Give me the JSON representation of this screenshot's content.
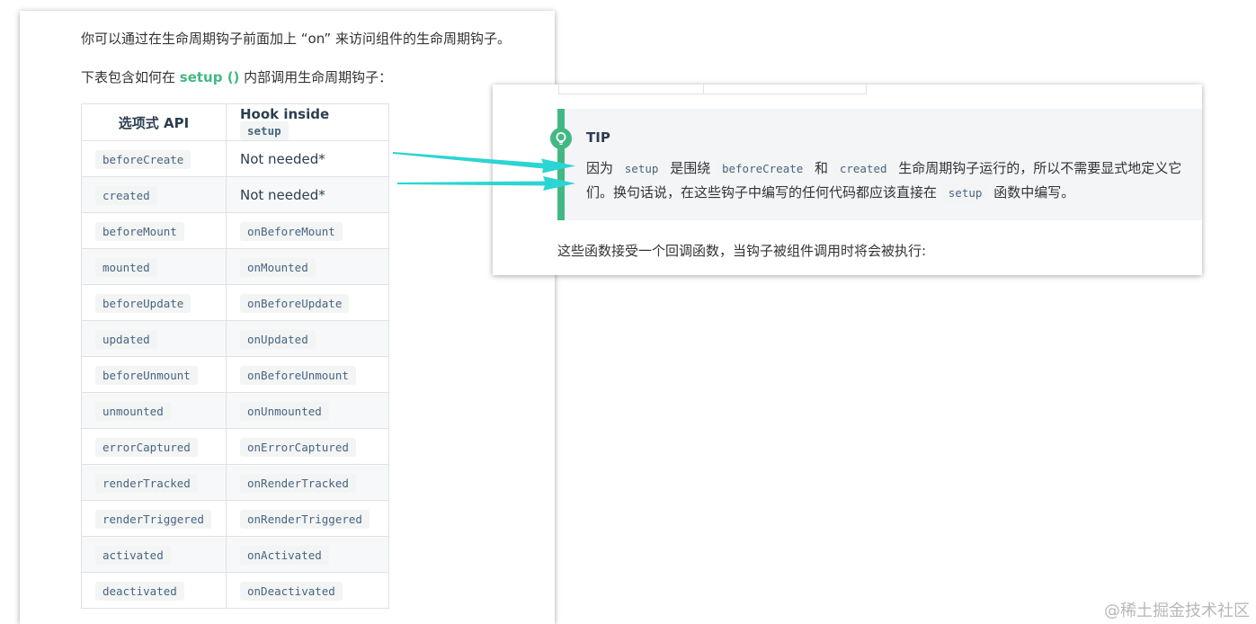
{
  "left": {
    "intro1": "你可以通过在生命周期钩子前面加上 “on” 来访问组件的生命周期钩子。",
    "intro2_prefix": "下表包含如何在 ",
    "intro2_link": "setup ()",
    "intro2_suffix": " 内部调用生命周期钩子：",
    "table": {
      "header_col1": "选项式 API",
      "header_col2_text": "Hook inside ",
      "header_col2_code": "setup",
      "rows": [
        {
          "option": "beforeCreate",
          "hook": "Not needed*",
          "hook_is_code": false
        },
        {
          "option": "created",
          "hook": "Not needed*",
          "hook_is_code": false
        },
        {
          "option": "beforeMount",
          "hook": "onBeforeMount",
          "hook_is_code": true
        },
        {
          "option": "mounted",
          "hook": "onMounted",
          "hook_is_code": true
        },
        {
          "option": "beforeUpdate",
          "hook": "onBeforeUpdate",
          "hook_is_code": true
        },
        {
          "option": "updated",
          "hook": "onUpdated",
          "hook_is_code": true
        },
        {
          "option": "beforeUnmount",
          "hook": "onBeforeUnmount",
          "hook_is_code": true
        },
        {
          "option": "unmounted",
          "hook": "onUnmounted",
          "hook_is_code": true
        },
        {
          "option": "errorCaptured",
          "hook": "onErrorCaptured",
          "hook_is_code": true
        },
        {
          "option": "renderTracked",
          "hook": "onRenderTracked",
          "hook_is_code": true
        },
        {
          "option": "renderTriggered",
          "hook": "onRenderTriggered",
          "hook_is_code": true
        },
        {
          "option": "activated",
          "hook": "onActivated",
          "hook_is_code": true
        },
        {
          "option": "deactivated",
          "hook": "onDeactivated",
          "hook_is_code": true
        }
      ]
    }
  },
  "right": {
    "tip_title": "TIP",
    "tip_icon": "lightbulb-icon",
    "tip_segments": [
      {
        "text": "因为 ",
        "code": false
      },
      {
        "text": "setup",
        "code": true
      },
      {
        "text": " 是围绕 ",
        "code": false
      },
      {
        "text": "beforeCreate",
        "code": true
      },
      {
        "text": " 和 ",
        "code": false
      },
      {
        "text": "created",
        "code": true
      },
      {
        "text": " 生命周期钩子运行的，所以不需要显式地定义它们。换句话说，在这些钩子中编写的任何代码都应该直接在 ",
        "code": false
      },
      {
        "text": "setup",
        "code": true
      },
      {
        "text": " 函数中编写。",
        "code": false
      }
    ],
    "footer": "这些函数接受一个回调函数，当钩子被组件调用时将会被执行:"
  },
  "watermark": "@稀土掘金技术社区",
  "colors": {
    "accent": "#42b983",
    "arrow": "#2dd4d4",
    "code_bg": "#f3f4f4",
    "tip_bg": "#f3f5f7"
  }
}
